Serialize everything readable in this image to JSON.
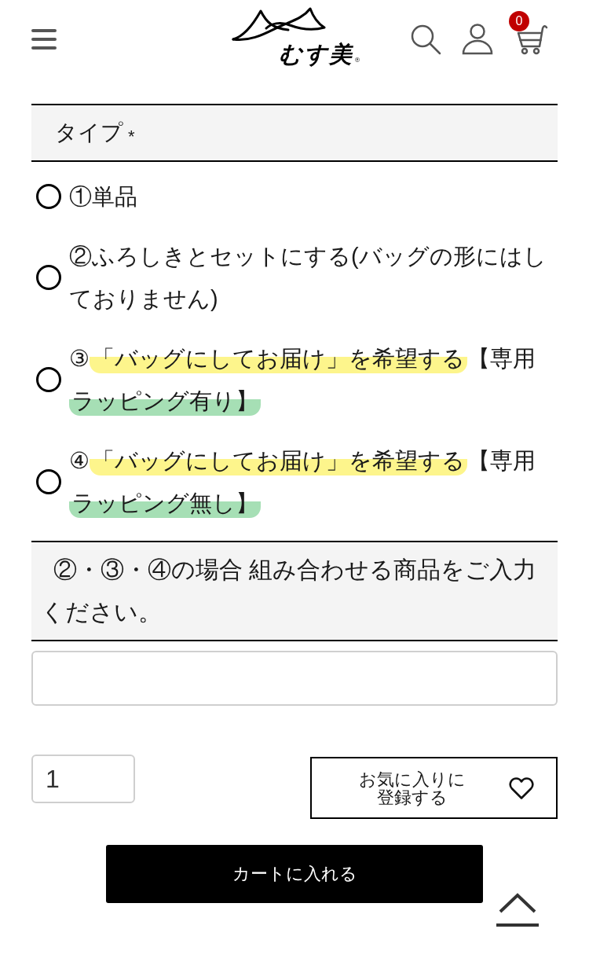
{
  "header": {
    "logo": {
      "text": "むす美",
      "mark": "®"
    },
    "cart_count": "0"
  },
  "type_section": {
    "label": "タイプ",
    "required_mark": "*"
  },
  "options": [
    {
      "selected": false,
      "segments": [
        {
          "text": "①単品"
        }
      ]
    },
    {
      "selected": false,
      "segments": [
        {
          "text": "②ふろしきとセットにする(バッグの形にはしておりません)"
        }
      ]
    },
    {
      "selected": false,
      "segments": [
        {
          "text": "③"
        },
        {
          "text": "「バッグにしてお届け」を希望する",
          "color": "#fdf58c"
        },
        {
          "text": "【専用"
        },
        {
          "text": "ラッピング有り】",
          "color": "#a6dfb5"
        }
      ]
    },
    {
      "selected": false,
      "segments": [
        {
          "text": "④"
        },
        {
          "text": "「バッグにしてお届け」を希望する",
          "color": "#fdf58c"
        },
        {
          "text": "【専用"
        },
        {
          "text": "ラッピング無し】",
          "color": "#a6dfb5"
        }
      ]
    }
  ],
  "combo_section": {
    "label": "②・③・④の場合 組み合わせる商品をご入力ください。"
  },
  "quantity": {
    "value": "1"
  },
  "favorite_button": {
    "label": "お気に入りに登録する"
  },
  "cart_button": {
    "label": "カートに入れる"
  }
}
